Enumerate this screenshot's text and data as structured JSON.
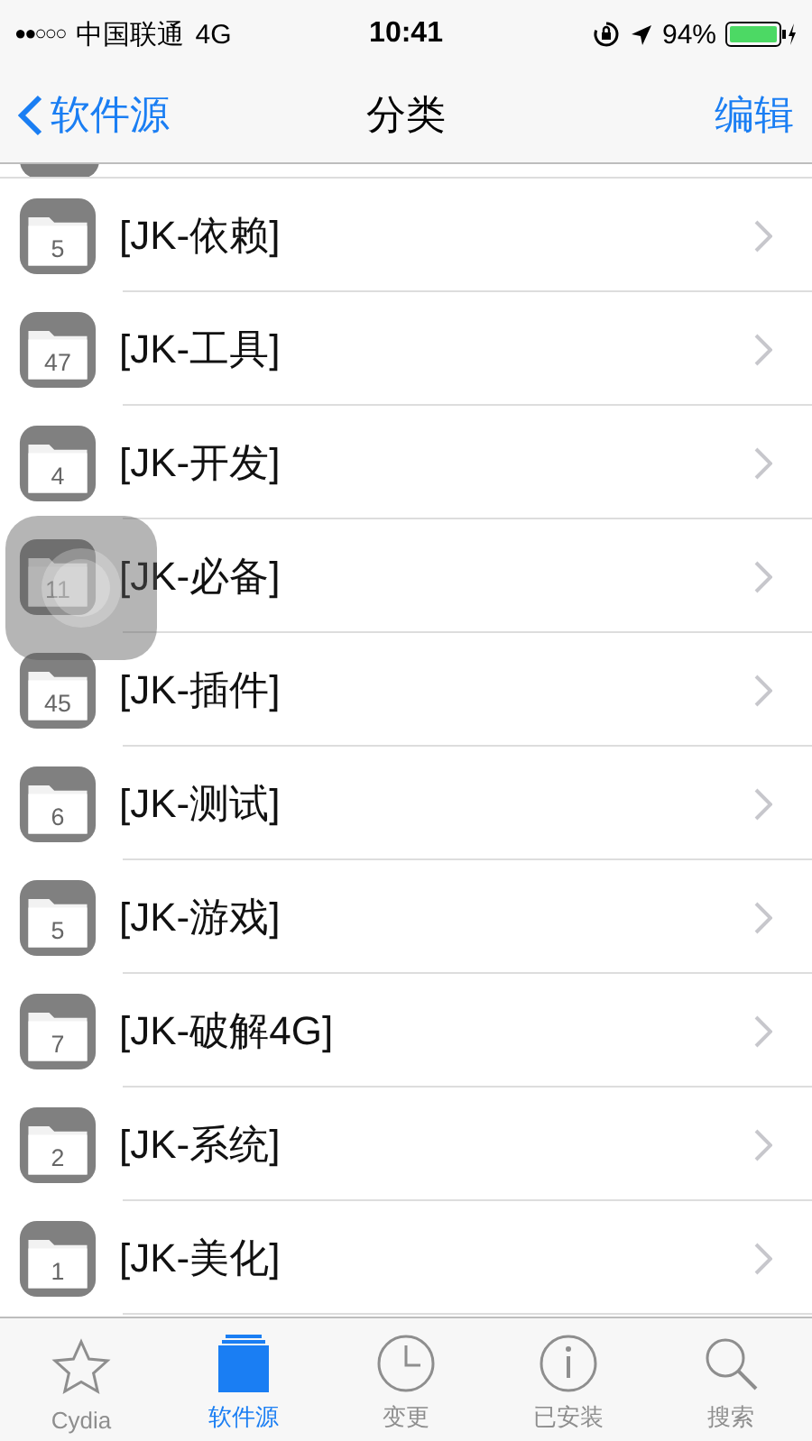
{
  "status_bar": {
    "signal": "●●○○○",
    "carrier": "中国联通",
    "network": "4G",
    "time": "10:41",
    "battery": "94%"
  },
  "nav": {
    "back": "软件源",
    "title": "分类",
    "action": "编辑"
  },
  "sections": [
    {
      "count": "5",
      "name": "[JK-依赖]"
    },
    {
      "count": "47",
      "name": "[JK-工具]"
    },
    {
      "count": "4",
      "name": "[JK-开发]"
    },
    {
      "count": "11",
      "name": "[JK-必备]"
    },
    {
      "count": "45",
      "name": "[JK-插件]"
    },
    {
      "count": "6",
      "name": "[JK-测试]"
    },
    {
      "count": "5",
      "name": "[JK-游戏]"
    },
    {
      "count": "7",
      "name": "[JK-破解4G]"
    },
    {
      "count": "2",
      "name": "[JK-系统]"
    },
    {
      "count": "1",
      "name": "[JK-美化]"
    }
  ],
  "tabs": [
    {
      "kind": "star",
      "label": "Cydia",
      "selected": false
    },
    {
      "kind": "sources",
      "label": "软件源",
      "selected": true
    },
    {
      "kind": "clock",
      "label": "变更",
      "selected": false
    },
    {
      "kind": "installed",
      "label": "已安装",
      "selected": false
    },
    {
      "kind": "search",
      "label": "搜索",
      "selected": false
    }
  ]
}
